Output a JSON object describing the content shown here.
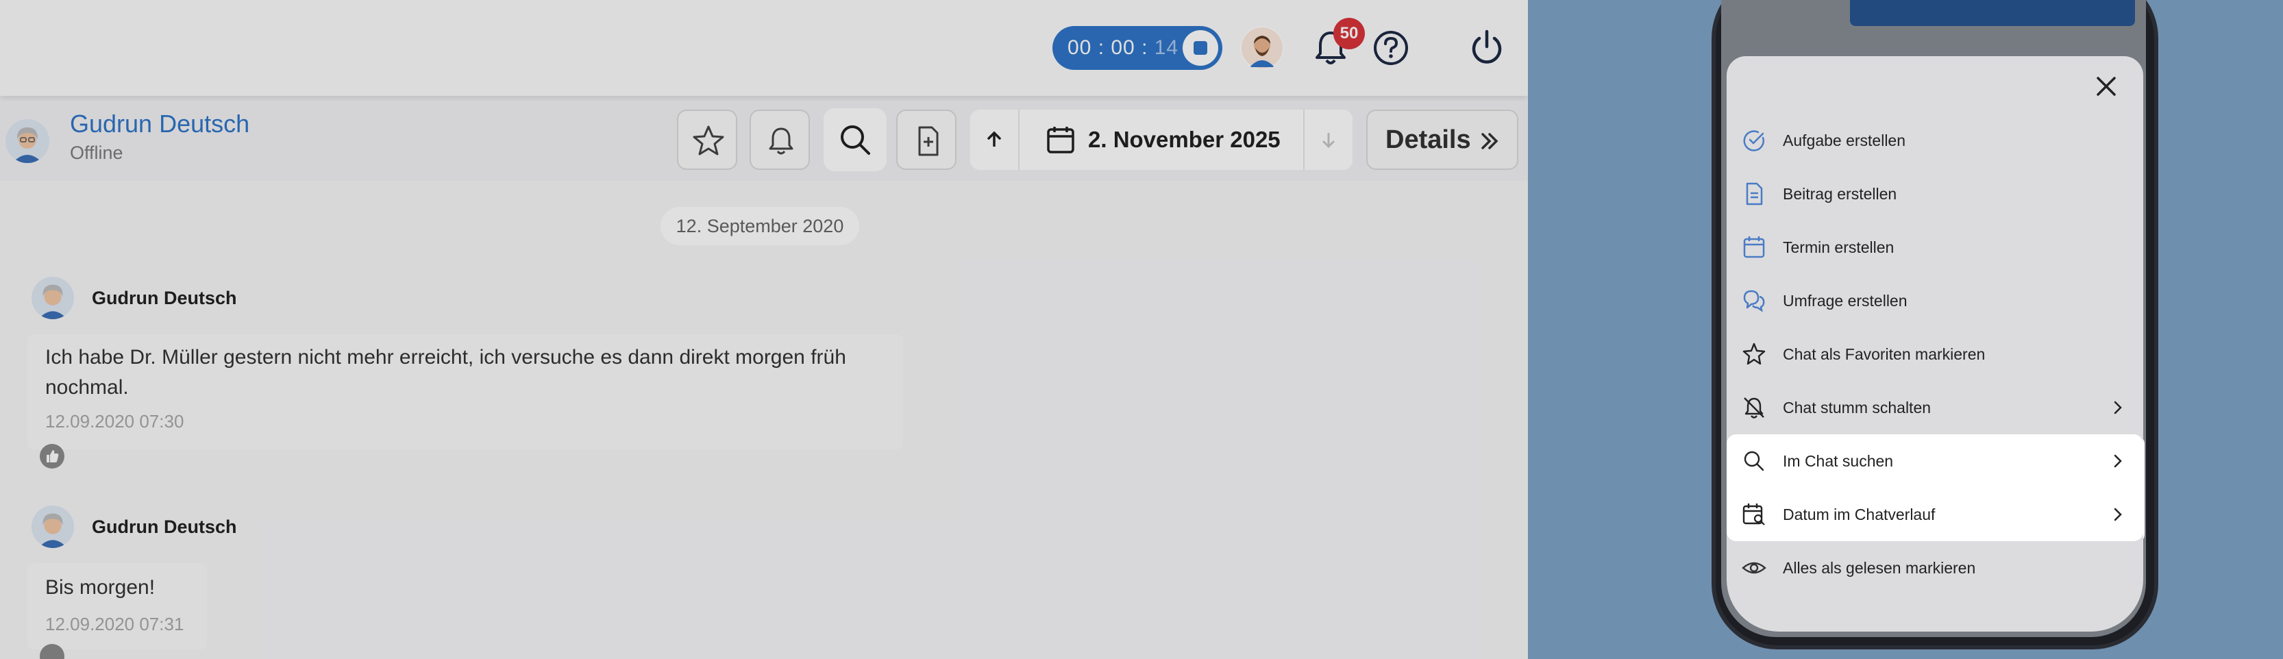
{
  "timer": {
    "main": "00 : 00 : ",
    "seconds": "14"
  },
  "notifications": {
    "count": "50"
  },
  "chat": {
    "name": "Gudrun Deutsch",
    "status": "Offline"
  },
  "datenav": {
    "date": "2. November 2025"
  },
  "details_label": "Details",
  "timeline": {
    "date_pill": "12. September 2020",
    "messages": [
      {
        "author": "Gudrun Deutsch",
        "line1": "Ich habe Dr. Müller gestern nicht mehr erreicht, ich versuche es dann direkt morgen früh",
        "line2": "nochmal.",
        "time": "12.09.2020 07:30"
      },
      {
        "author": "Gudrun Deutsch",
        "line1": "Bis morgen!",
        "time": "12.09.2020 07:31"
      }
    ]
  },
  "mobile_menu": {
    "items": [
      {
        "label": "Aufgabe erstellen",
        "icon": "check-circle-icon"
      },
      {
        "label": "Beitrag erstellen",
        "icon": "document-icon"
      },
      {
        "label": "Termin erstellen",
        "icon": "calendar-icon"
      },
      {
        "label": "Umfrage erstellen",
        "icon": "poll-icon"
      },
      {
        "label": "Chat als Favoriten markieren",
        "icon": "star-icon"
      },
      {
        "label": "Chat stumm schalten",
        "icon": "bell-off-icon"
      },
      {
        "label": "Im Chat suchen",
        "icon": "search-icon"
      },
      {
        "label": "Datum im Chatverlauf",
        "icon": "calendar-search-icon"
      },
      {
        "label": "Alles als gelesen markieren",
        "icon": "eye-icon"
      }
    ]
  },
  "colors": {
    "accent": "#2f75c8",
    "badge": "#d9343a",
    "background": "#6f8fae"
  }
}
